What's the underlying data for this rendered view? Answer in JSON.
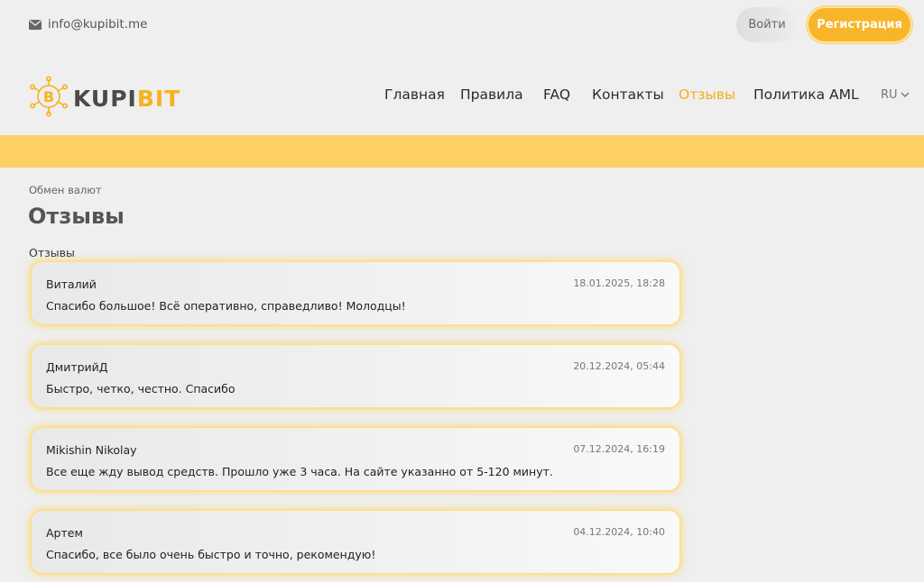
{
  "topbar": {
    "email": "info@kupibit.me",
    "login_label": "Войти",
    "register_label": "Регистрация"
  },
  "logo": {
    "part1": "KUPI",
    "part2": "BIT"
  },
  "nav": {
    "items": [
      {
        "label": "Главная"
      },
      {
        "label": "Правила"
      },
      {
        "label": "FAQ"
      },
      {
        "label": "Контакты"
      },
      {
        "label": "Отзывы",
        "active": true
      },
      {
        "label": "Политика AML"
      }
    ],
    "language": "RU"
  },
  "breadcrumb": "Обмен валют",
  "page_title": "Отзывы",
  "section_label": "Отзывы",
  "reviews": [
    {
      "name": "Виталий",
      "date": "18.01.2025, 18:28",
      "text": "Спасибо большое! Всё оперативно, справедливо! Молодцы!"
    },
    {
      "name": "ДмитрийД",
      "date": "20.12.2024, 05:44",
      "text": "Быстро, четко, честно. Спасибо"
    },
    {
      "name": "Mikishin Nikolay",
      "date": "07.12.2024, 16:19",
      "text": "Все еще жду вывод средств. Прошло уже 3 часа. На сайте указанно от 5-120 минут."
    },
    {
      "name": "Артем",
      "date": "04.12.2024, 10:40",
      "text": "Спасибо, все было очень быстро и точно, рекомендую!"
    }
  ],
  "colors": {
    "accent": "#f8b52a",
    "band": "#fed064",
    "active_nav": "#f4ae1c"
  },
  "icons": {
    "email": "envelope-icon",
    "logo": "bitcoin-network-icon",
    "lang": "chevron-down-icon"
  }
}
